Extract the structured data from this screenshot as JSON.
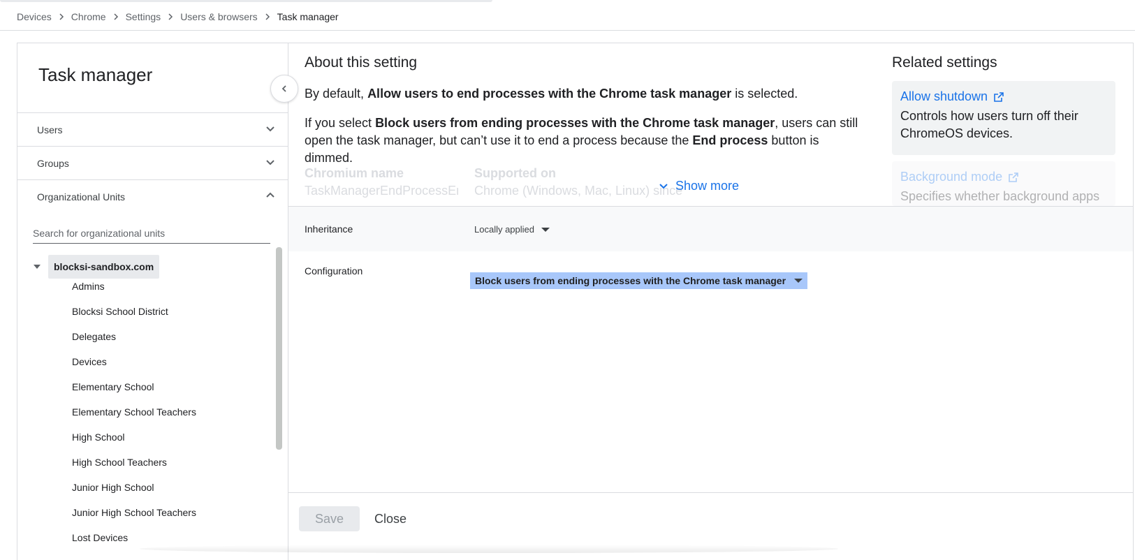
{
  "breadcrumb": [
    "Devices",
    "Chrome",
    "Settings",
    "Users & browsers",
    "Task manager"
  ],
  "left": {
    "title": "Task manager",
    "filters": [
      {
        "label": "Users",
        "expanded": false
      },
      {
        "label": "Groups",
        "expanded": false
      },
      {
        "label": "Organizational Units",
        "expanded": true
      }
    ],
    "search_placeholder": "Search for organizational units",
    "root": "blocksi-sandbox.com",
    "children": [
      "Admins",
      "Blocksi School District",
      "Delegates",
      "Devices",
      "Elementary School",
      "Elementary School Teachers",
      "High School",
      "High School Teachers",
      "Junior High School",
      "Junior High School Teachers",
      "Lost Devices"
    ]
  },
  "about": {
    "heading": "About this setting",
    "p1_a": "By default, ",
    "p1_bold": "Allow users to end processes with the Chrome task manager",
    "p1_b": " is selected.",
    "p2_a": "If you select ",
    "p2_bold": "Block users from ending processes with the Chrome task manager",
    "p2_b": ", users can still open the task manager, but can’t use it to end a process because the ",
    "p2_bold2": "End process",
    "p2_c": " button is dimmed.",
    "chromium_name_h": "Chromium name",
    "chromium_name_v": "TaskManagerEndProcessEn",
    "supported_on_h": "Supported on",
    "supported_on_v": "Chrome (Windows, Mac, Linux) since",
    "show_more": "Show more"
  },
  "related": {
    "heading": "Related settings",
    "items": [
      {
        "title": "Allow shutdown",
        "desc": "Controls how users turn off their ChromeOS devices."
      },
      {
        "title": "Background mode",
        "desc": "Specifies whether background apps"
      }
    ]
  },
  "inheritance": {
    "label": "Inheritance",
    "value": "Locally applied"
  },
  "configuration": {
    "label": "Configuration",
    "value": "Block users from ending processes with the Chrome task manager"
  },
  "footer": {
    "save": "Save",
    "close": "Close"
  },
  "colors": {
    "accent": "#1a73e8",
    "selected": "#a8c7fa",
    "border": "#dadce0"
  }
}
